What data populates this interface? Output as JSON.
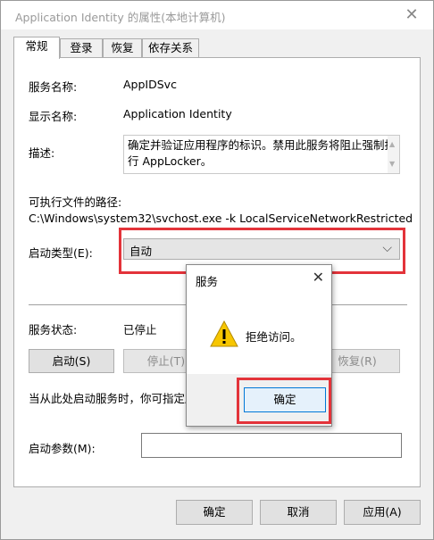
{
  "window": {
    "title": "Application Identity 的属性(本地计算机)",
    "close_glyph": "✕"
  },
  "tabs": [
    {
      "label": "常规",
      "active": true
    },
    {
      "label": "登录"
    },
    {
      "label": "恢复"
    },
    {
      "label": "依存关系"
    }
  ],
  "general": {
    "service_name_label": "服务名称:",
    "service_name": "AppIDSvc",
    "display_name_label": "显示名称:",
    "display_name": "Application Identity",
    "description_label": "描述:",
    "description": "确定并验证应用程序的标识。禁用此服务将阻止强制执行 AppLocker。",
    "path_label": "可执行文件的路径:",
    "path": "C:\\Windows\\system32\\svchost.exe -k LocalServiceNetworkRestricted",
    "startup_type_label": "启动类型(E):",
    "startup_type": "自动",
    "status_label": "服务状态:",
    "status": "已停止",
    "buttons": {
      "start": "启动(S)",
      "stop": "停止(T)",
      "resume": "恢复(R)"
    },
    "hint": "当从此处启动服务时，你可指定所",
    "params_label": "启动参数(M):",
    "params_value": ""
  },
  "footer": {
    "ok": "确定",
    "cancel": "取消",
    "apply": "应用(A)"
  },
  "dialog": {
    "title": "服务",
    "close_glyph": "✕",
    "message": "拒绝访问。",
    "ok": "确定",
    "icon": "warning-icon"
  },
  "colors": {
    "highlight": "#e3333a",
    "warning_yellow": "#f7c600",
    "focus_blue": "#0078d7"
  }
}
